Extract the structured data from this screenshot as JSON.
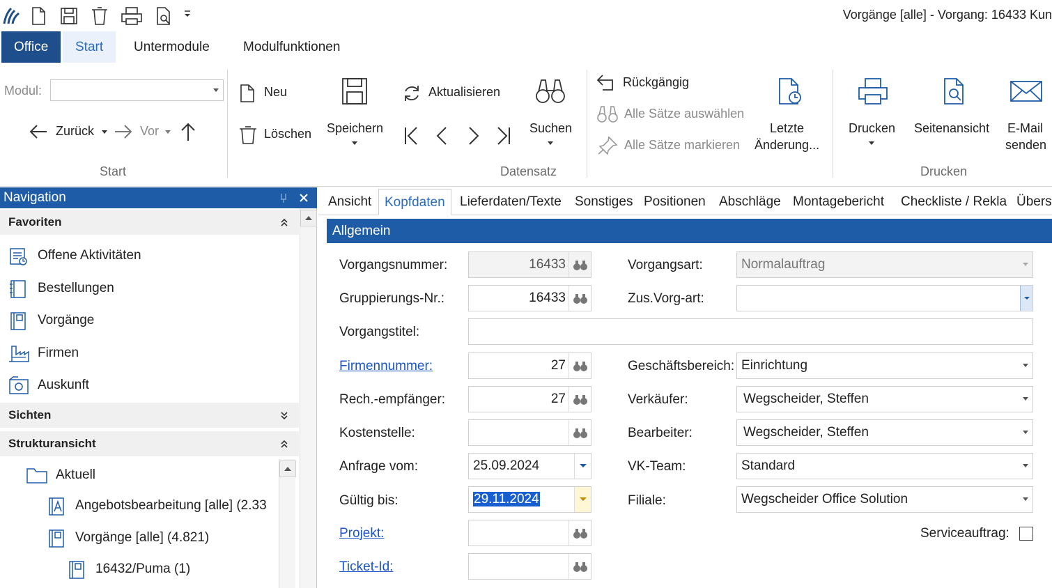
{
  "window": {
    "title": "Vorgänge [alle] - Vorgang: 16433 Kun"
  },
  "quick_access": [
    "app-logo-icon",
    "new-document-icon",
    "save-icon",
    "delete-icon",
    "print-icon",
    "page-preview-icon",
    "customize-dropdown-icon"
  ],
  "menu": {
    "office": "Office",
    "start": "Start",
    "untermodule": "Untermodule",
    "modulfunktionen": "Modulfunktionen"
  },
  "ribbon": {
    "modul_label": "Modul:",
    "modul_value": "",
    "zurueck": "Zurück",
    "vor": "Vor",
    "group_start": "Start",
    "neu": "Neu",
    "loeschen": "Löschen",
    "speichern": "Speichern",
    "aktualisieren": "Aktualisieren",
    "suchen": "Suchen",
    "rueckgaengig": "Rückgängig",
    "alle_auswaehlen": "Alle Sätze auswählen",
    "alle_markieren": "Alle Sätze markieren",
    "letzte_1": "Letzte",
    "letzte_2": "Änderung...",
    "group_datensatz": "Datensatz",
    "drucken": "Drucken",
    "seitenansicht": "Seitenansicht",
    "email_1": "E-Mail",
    "email_2": "senden",
    "group_drucken": "Drucken"
  },
  "nav": {
    "title": "Navigation",
    "favoriten": "Favoriten",
    "items": [
      {
        "label": "Offene Aktivitäten"
      },
      {
        "label": "Bestellungen"
      },
      {
        "label": "Vorgänge"
      },
      {
        "label": "Firmen"
      },
      {
        "label": "Auskunft"
      }
    ],
    "sichten": "Sichten",
    "strukturansicht": "Strukturansicht",
    "tree": [
      {
        "label": "Aktuell"
      },
      {
        "label": "Angebotsbearbeitung [alle] (2.33"
      },
      {
        "label": "Vorgänge [alle] (4.821)"
      },
      {
        "label": "16432/Puma (1)"
      }
    ]
  },
  "tabs": [
    "Ansicht",
    "Kopfdaten",
    "Lieferdaten/Texte",
    "Sonstiges",
    "Positionen",
    "Abschläge",
    "Montagebericht",
    "Checkliste / Rekla",
    "Übers"
  ],
  "section": "Allgemein",
  "form": {
    "vorgangsnummer_label": "Vorgangsnummer:",
    "vorgangsnummer": "16433",
    "gruppierung_label": "Gruppierungs-Nr.:",
    "gruppierung": "16433",
    "vorgangstitel_label": "Vorgangstitel:",
    "vorgangstitel": "",
    "firmennummer_label": "Firmennummer:",
    "firmennummer": "27",
    "rech_label": "Rech.-empfänger:",
    "rech": "27",
    "kostenstelle_label": "Kostenstelle:",
    "kostenstelle": "",
    "anfrage_label": "Anfrage vom:",
    "anfrage": "25.09.2024",
    "gueltig_label": "Gültig bis:",
    "gueltig": "29.11.2024",
    "projekt_label": "Projekt:",
    "projekt": "",
    "ticket_label": "Ticket-Id:",
    "ticket": "",
    "vorgangsart_label": "Vorgangsart:",
    "vorgangsart": "Normalauftrag",
    "zus_label": "Zus.Vorg-art:",
    "zus": "",
    "geschaeft_label": "Geschäftsbereich:",
    "geschaeft": "Einrichtung",
    "verkaeufer_label": "Verkäufer:",
    "verkaeufer": "Wegscheider, Steffen",
    "bearbeiter_label": "Bearbeiter:",
    "bearbeiter": "Wegscheider, Steffen",
    "vkteam_label": "VK-Team:",
    "vkteam": "Standard",
    "filiale_label": "Filiale:",
    "filiale": "Wegscheider Office Solution",
    "service_label": "Serviceauftrag:",
    "service_checked": false
  },
  "colors": {
    "accent": "#1f5ca8",
    "office_tab": "#1f4e8c",
    "link": "#1a55c8",
    "selection": "#1a5fd0"
  }
}
